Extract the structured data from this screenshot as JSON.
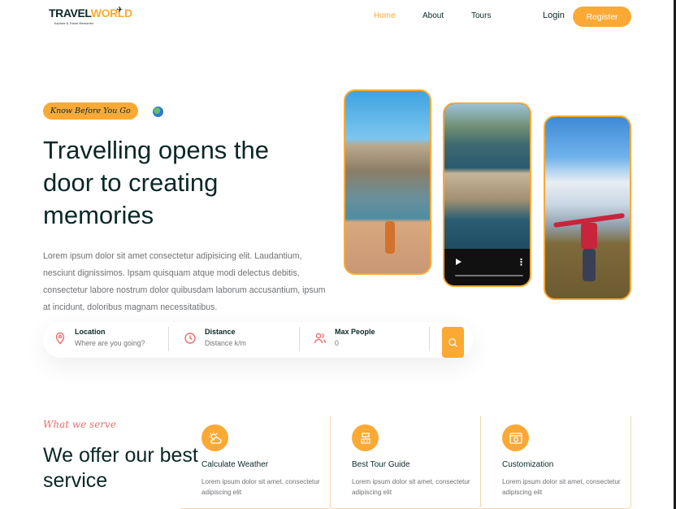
{
  "colors": {
    "accent": "#faa935",
    "heading": "#0b2727",
    "secondary": "#ee6e6e",
    "text": "#6e7074"
  },
  "header": {
    "logo": {
      "part1": "TRAVEL",
      "part2": "WORLD",
      "tagline": "Explore & Travel Memories",
      "icon": "airplane-icon"
    },
    "nav": [
      {
        "label": "Home"
      },
      {
        "label": "About"
      },
      {
        "label": "Tours"
      }
    ],
    "login": "Login",
    "register": "Register"
  },
  "hero": {
    "badge": "Know Before You Go",
    "title": "Travelling opens the door to creating memories",
    "text": "Lorem ipsum dolor sit amet consectetur adipisicing elit. Laudantium, nesciunt dignissimos. Ipsam quisquam atque modi delectus debitis, consectetur labore nostrum dolor quibusdam laborum accusantium, ipsum at incidunt, doloribus magnam necessitatibus."
  },
  "search": {
    "location": {
      "label": "Location",
      "placeholder": "Where are you going?",
      "icon": "map-pin-icon"
    },
    "distance": {
      "label": "Distance",
      "placeholder": "Distance k/m",
      "icon": "clock-icon"
    },
    "people": {
      "label": "Max People",
      "placeholder": "0",
      "icon": "people-icon"
    },
    "button_icon": "search-icon"
  },
  "services": {
    "subtitle": "What we serve",
    "title": "We offer our best service",
    "cards": [
      {
        "title": "Calculate Weather",
        "text": "Lorem ipsum dolor sit amet, consectetur adipiscing elit",
        "icon": "weather-icon"
      },
      {
        "title": "Best Tour Guide",
        "text": "Lorem ipsum dolor sit amet, consectetur adipiscing elit",
        "icon": "guide-icon"
      },
      {
        "title": "Customization",
        "text": "Lorem ipsum dolor sit amet, consectetur adipiscing elit",
        "icon": "customize-icon"
      }
    ]
  }
}
